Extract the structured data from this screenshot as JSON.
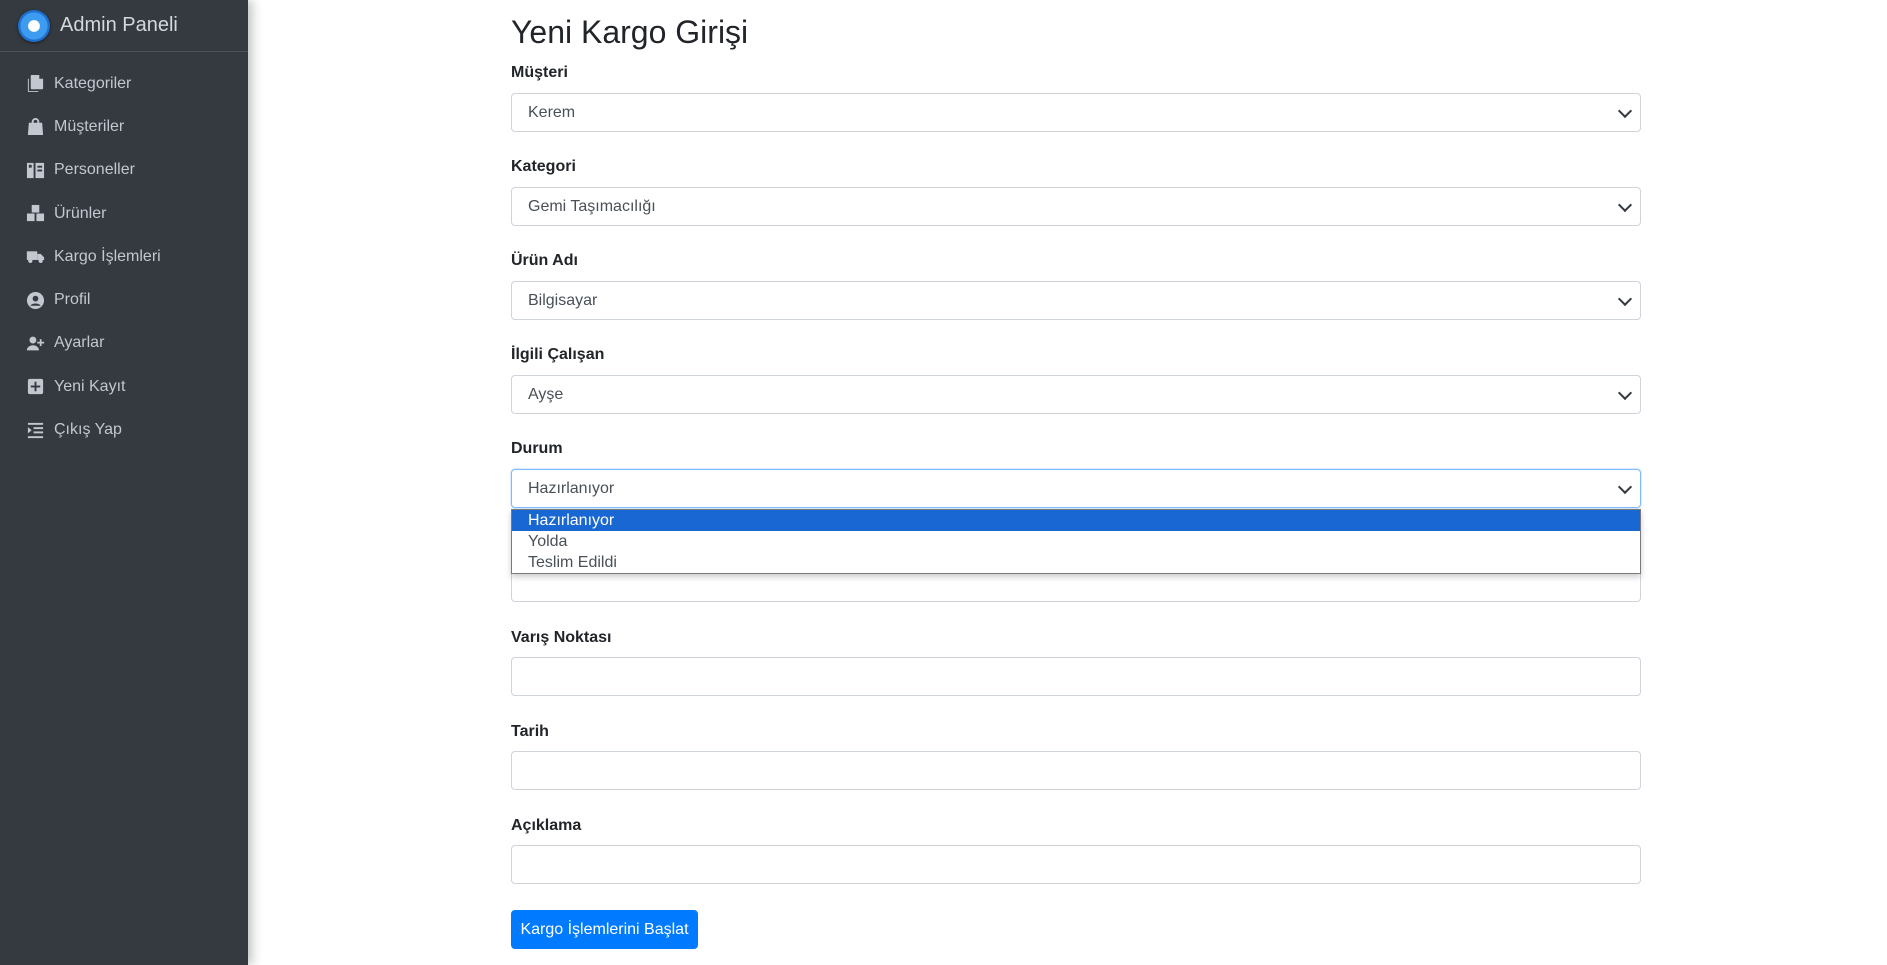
{
  "brand": {
    "title": "Admin Paneli"
  },
  "sidebar": {
    "items": [
      {
        "label": "Kategoriler",
        "icon": "copy-icon"
      },
      {
        "label": "Müşteriler",
        "icon": "shopping-bag-icon"
      },
      {
        "label": "Personeller",
        "icon": "users-icon"
      },
      {
        "label": "Ürünler",
        "icon": "boxes-icon"
      },
      {
        "label": "Kargo İşlemleri",
        "icon": "truck-icon"
      },
      {
        "label": "Profil",
        "icon": "user-circle-icon"
      },
      {
        "label": "Ayarlar",
        "icon": "user-plus-icon"
      },
      {
        "label": "Yeni Kayıt",
        "icon": "plus-square-icon"
      },
      {
        "label": "Çıkış Yap",
        "icon": "list-indent-icon"
      }
    ]
  },
  "form": {
    "title": "Yeni Kargo Girişi",
    "musteri": {
      "label": "Müşteri",
      "value": "Kerem"
    },
    "kategori": {
      "label": "Kategori",
      "value": "Gemi Taşımacılığı"
    },
    "urun": {
      "label": "Ürün Adı",
      "value": "Bilgisayar"
    },
    "calisan": {
      "label": "İlgili Çalışan",
      "value": "Ayşe"
    },
    "durum": {
      "label": "Durum",
      "value": "Hazırlanıyor",
      "options": [
        "Hazırlanıyor",
        "Yolda",
        "Teslim Edildi"
      ]
    },
    "varis": {
      "label": "Varış Noktası",
      "value": ""
    },
    "tarih": {
      "label": "Tarih",
      "value": ""
    },
    "aciklama": {
      "label": "Açıklama",
      "value": ""
    },
    "submit_label": "Kargo İşlemlerini Başlat"
  },
  "colors": {
    "sidebar_bg": "#343a40",
    "primary": "#007bff",
    "option_highlight": "#1967d2"
  }
}
